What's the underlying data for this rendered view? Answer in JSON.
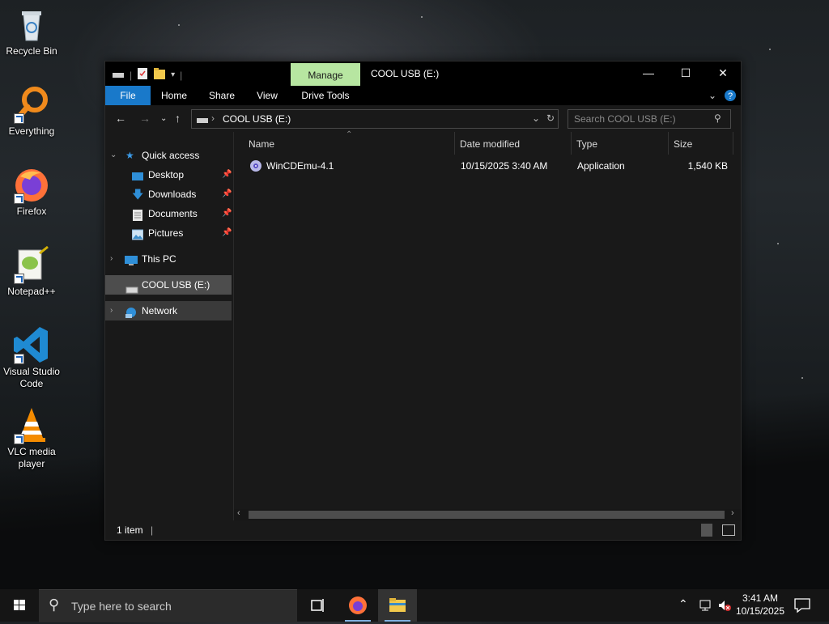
{
  "desktop": {
    "icons": [
      {
        "label": "Recycle Bin",
        "icon": "recycle-bin-icon"
      },
      {
        "label": "Everything",
        "icon": "everything-search-icon"
      },
      {
        "label": "Firefox",
        "icon": "firefox-icon"
      },
      {
        "label": "Notepad++",
        "icon": "notepad-plus-plus-icon"
      },
      {
        "label": "Visual Studio Code",
        "icon": "vscode-icon"
      },
      {
        "label": "VLC media player",
        "icon": "vlc-icon"
      }
    ]
  },
  "window": {
    "title": "COOL USB (E:)",
    "manage_label": "Manage",
    "ribbon_tabs": [
      "File",
      "Home",
      "Share",
      "View",
      "Drive Tools"
    ],
    "accent_color": "#1979ca",
    "manage_color": "#b7e6a1",
    "address_path": "COOL USB (E:)",
    "search_placeholder": "Search COOL USB (E:)",
    "nav": {
      "quick_access": "Quick access",
      "quick_items": [
        "Desktop",
        "Downloads",
        "Documents",
        "Pictures"
      ],
      "this_pc": "This PC",
      "drive": "COOL USB (E:)",
      "network": "Network"
    },
    "columns": [
      "Name",
      "Date modified",
      "Type",
      "Size"
    ],
    "files": [
      {
        "name": "WinCDEmu-4.1",
        "date": "10/15/2025 3:40 AM",
        "type": "Application",
        "size": "1,540 KB"
      }
    ],
    "status": "1 item"
  },
  "taskbar": {
    "search_placeholder": "Type here to search",
    "time": "3:41 AM",
    "date": "10/15/2025"
  }
}
